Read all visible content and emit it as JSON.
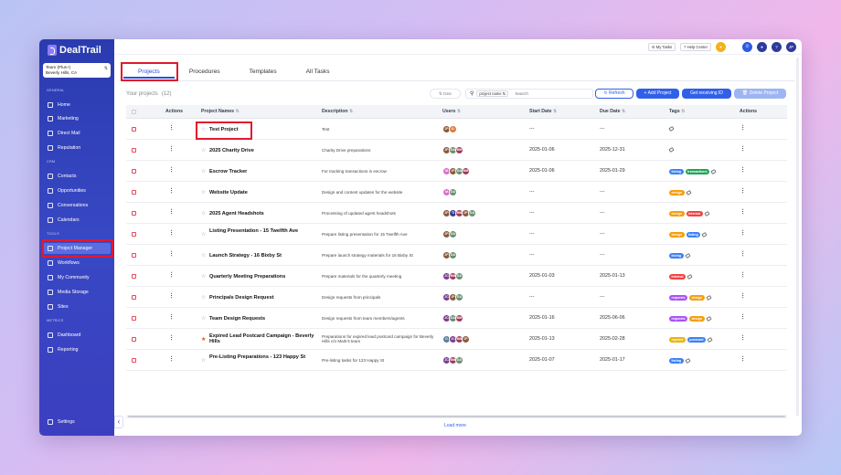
{
  "app": {
    "name": "DealTrail"
  },
  "team": {
    "name": "Team (Plus+)",
    "location": "Beverly Hills, CA"
  },
  "sidebar": {
    "sections": {
      "general": "GENERAL",
      "crm": "CRM",
      "tools": "TOOLS",
      "metrics": "METRICS"
    },
    "items": [
      {
        "label": "Home",
        "icon": "home-icon"
      },
      {
        "label": "Marketing",
        "icon": "marketing-icon"
      },
      {
        "label": "Direct Mail",
        "icon": "mail-icon"
      },
      {
        "label": "Reputation",
        "icon": "star-icon"
      },
      {
        "label": "Contacts",
        "icon": "contacts-icon"
      },
      {
        "label": "Opportunities",
        "icon": "opportunities-icon"
      },
      {
        "label": "Conversations",
        "icon": "chat-icon"
      },
      {
        "label": "Calendars",
        "icon": "calendar-icon"
      },
      {
        "label": "Project Manager",
        "icon": "list-icon",
        "active": true
      },
      {
        "label": "Workflows",
        "icon": "workflow-icon"
      },
      {
        "label": "My Community",
        "icon": "community-icon"
      },
      {
        "label": "Media Storage",
        "icon": "image-icon"
      },
      {
        "label": "Sites",
        "icon": "globe-icon"
      },
      {
        "label": "Dashboard",
        "icon": "dashboard-icon"
      },
      {
        "label": "Reporting",
        "icon": "reporting-icon"
      }
    ],
    "settings": "Settings"
  },
  "topbar": {
    "my_tasks": "My Tasks",
    "help_center": "Help Center",
    "user_initials": "JP"
  },
  "tabs": [
    "Projects",
    "Procedures",
    "Templates",
    "All Tasks"
  ],
  "toolbar": {
    "title": "Your projects",
    "count": "(12)",
    "date_filter": "Date",
    "search_field": "project name",
    "search_placeholder": "Search",
    "refresh": "Refresh",
    "add_project": "+ Add Project",
    "get_receiving_id": "Get receiving ID",
    "delete_project": "Delete Project"
  },
  "table": {
    "columns": {
      "actions": "Actions",
      "name": "Project Names",
      "description": "Description",
      "users": "Users",
      "start": "Start Date",
      "due": "Due Date",
      "tags": "Tags",
      "actions2": "Actions"
    },
    "rows": [
      {
        "name": "Test Project",
        "starred": false,
        "description": "Test",
        "users": [
          "JP",
          "JL"
        ],
        "start": "---",
        "due": "---",
        "tags": []
      },
      {
        "name": "2025 Charity Drive",
        "starred": false,
        "description": "Charity Drive preparations",
        "users": [
          "JP",
          "DA",
          "MM"
        ],
        "start": "2025-01-06",
        "due": "2025-12-31",
        "tags": []
      },
      {
        "name": "Escrow Tracker",
        "starred": false,
        "description": "For tracking transactions in escrow",
        "users": [
          "M",
          "JP",
          "DA",
          "MM"
        ],
        "start": "2025-01-06",
        "due": "2025-01-29",
        "tags": [
          "listing",
          "transactions"
        ]
      },
      {
        "name": "Website Update",
        "starred": false,
        "description": "Design and content updates for the website",
        "users": [
          "M",
          "DA"
        ],
        "start": "---",
        "due": "---",
        "tags": [
          "design"
        ]
      },
      {
        "name": "2025 Agent Headshots",
        "starred": false,
        "description": "Processing of updated agent headshots",
        "users": [
          "JP",
          "TI",
          "MM",
          "JP",
          "DA"
        ],
        "start": "---",
        "due": "---",
        "tags": [
          "design",
          "internal"
        ]
      },
      {
        "name": "Listing Presentation - 15 Twelfth Ave",
        "starred": false,
        "description": "Prepare listing presentation for 15 Twelfth Ave",
        "users": [
          "JP",
          "DA"
        ],
        "start": "---",
        "due": "---",
        "tags": [
          "design",
          "listing"
        ]
      },
      {
        "name": "Launch Strategy - 16 Bixby St",
        "starred": false,
        "description": "Prepare launch strategy materials for 16 Bixby St",
        "users": [
          "JP",
          "DA"
        ],
        "start": "---",
        "due": "---",
        "tags": [
          "listing"
        ]
      },
      {
        "name": "Quarterly Meeting Preparations",
        "starred": false,
        "description": "Prepare materials for the quarterly meeting",
        "users": [
          "JC",
          "MM",
          "DA"
        ],
        "start": "2025-01-03",
        "due": "2025-01-13",
        "tags": [
          "internal"
        ]
      },
      {
        "name": "Principals Design Request",
        "starred": false,
        "description": "Design requests from principals",
        "users": [
          "JC",
          "JP",
          "DA"
        ],
        "start": "---",
        "due": "---",
        "tags": [
          "requests",
          "design"
        ]
      },
      {
        "name": "Team Design Requests",
        "starred": false,
        "description": "Design requests from team members/agents",
        "users": [
          "JC",
          "DA",
          "MM"
        ],
        "start": "2025-01-16",
        "due": "2025-06-06",
        "tags": [
          "requests",
          "design"
        ]
      },
      {
        "name": "Expired Lead Postcard Campaign - Beverly Hills",
        "starred": true,
        "description": "Preparations for expired lead postcard campaign for Beverly Hills c/o Mark's team",
        "users": [
          "D",
          "JC",
          "MM",
          "JP"
        ],
        "start": "2025-01-13",
        "due": "2025-02-28",
        "tags": [
          "expired",
          "postcard"
        ]
      },
      {
        "name": "Pre-Listing Preparations - 123 Happy St",
        "starred": false,
        "description": "Pre-listing tasks for 123 Happy St",
        "users": [
          "JC",
          "MM",
          "DA"
        ],
        "start": "2025-01-07",
        "due": "2025-01-17",
        "tags": [
          "listing"
        ]
      }
    ]
  },
  "load_more": "Load more",
  "colors": {
    "sidebar": "#2a3bb0",
    "accent": "#3160e8",
    "highlight": "#e0192e",
    "tag_listing": "#3b82f6",
    "tag_transactions": "#22a559",
    "tag_design": "#f59e0b",
    "tag_internal": "#ef4444",
    "tag_requests": "#a855f7",
    "tag_expired": "#eab308",
    "tag_postcard": "#3b82f6"
  }
}
